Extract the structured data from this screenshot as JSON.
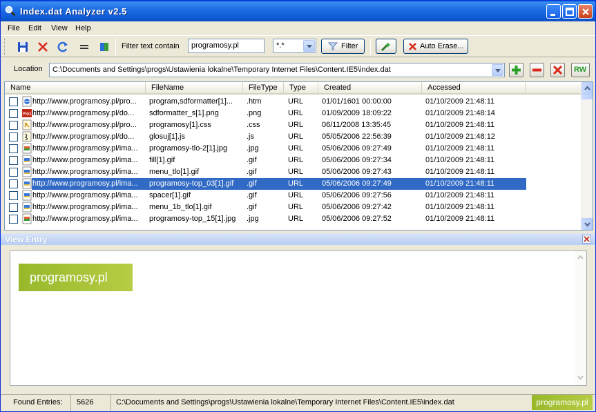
{
  "window": {
    "title": "Index.dat Analyzer v2.5"
  },
  "menu": [
    "File",
    "Edit",
    "View",
    "Help"
  ],
  "toolbar": {
    "filter_label": "Filter text contain",
    "filter_value": "programosy.pl",
    "ext_value": "*.*",
    "filter_button": "Filter",
    "auto_erase_button": "Auto Erase..."
  },
  "location": {
    "label": "Location",
    "path": "C:\\Documents and Settings\\progs\\Ustawienia lokalne\\Temporary Internet Files\\Content.IE5\\index.dat",
    "rw_label": "RW"
  },
  "columns": [
    "Name",
    "FileName",
    "FileType",
    "Type",
    "Created",
    "Accessed"
  ],
  "rows": [
    {
      "name": "http://www.programosy.pl/pro...",
      "file": "program,sdformatter[1]...",
      "ext": ".htm",
      "type": "URL",
      "created": "01/01/1601   00:00:00",
      "accessed": "01/10/2009   21:48:11",
      "icon": "htm-icon"
    },
    {
      "name": "http://www.programosy.pl/do...",
      "file": "sdformatter_s[1].png",
      "ext": ".png",
      "type": "URL",
      "created": "01/09/2009   18:09:22",
      "accessed": "01/10/2009   21:48:14",
      "icon": "png-icon"
    },
    {
      "name": "http://www.programosy.pl/pro...",
      "file": "programosy[1].css",
      "ext": ".css",
      "type": "URL",
      "created": "06/11/2008   13:35:45",
      "accessed": "01/10/2009   21:48:11",
      "icon": "css-icon"
    },
    {
      "name": "http://www.programosy.pl/do...",
      "file": "glosuj[1].js",
      "ext": ".js",
      "type": "URL",
      "created": "05/05/2006   22:56:39",
      "accessed": "01/10/2009   21:48:12",
      "icon": "js-icon"
    },
    {
      "name": "http://www.programosy.pl/ima...",
      "file": "programosy-tlo-2[1].jpg",
      "ext": ".jpg",
      "type": "URL",
      "created": "05/06/2006   09:27:49",
      "accessed": "01/10/2009   21:48:11",
      "icon": "jpg-icon"
    },
    {
      "name": "http://www.programosy.pl/ima...",
      "file": "fill[1].gif",
      "ext": ".gif",
      "type": "URL",
      "created": "05/06/2006   09:27:34",
      "accessed": "01/10/2009   21:48:11",
      "icon": "gif-icon"
    },
    {
      "name": "http://www.programosy.pl/ima...",
      "file": "menu_tlo[1].gif",
      "ext": ".gif",
      "type": "URL",
      "created": "05/06/2006   09:27:43",
      "accessed": "01/10/2009   21:48:11",
      "icon": "gif-icon"
    },
    {
      "name": "http://www.programosy.pl/ima...",
      "file": "programosy-top_03[1].gif",
      "ext": ".gif",
      "type": "URL",
      "created": "05/06/2006   09:27:49",
      "accessed": "01/10/2009   21:48:11",
      "icon": "gif-icon",
      "selected": true
    },
    {
      "name": "http://www.programosy.pl/ima...",
      "file": "spacer[1].gif",
      "ext": ".gif",
      "type": "URL",
      "created": "05/06/2006   09:27:56",
      "accessed": "01/10/2009   21:48:11",
      "icon": "gif-icon"
    },
    {
      "name": "http://www.programosy.pl/ima...",
      "file": "menu_1b_tlo[1].gif",
      "ext": ".gif",
      "type": "URL",
      "created": "05/06/2006   09:27:42",
      "accessed": "01/10/2009   21:48:11",
      "icon": "gif-icon"
    },
    {
      "name": "http://www.programosy.pl/ima...",
      "file": "programosy-top_15[1].jpg",
      "ext": ".jpg",
      "type": "URL",
      "created": "05/06/2006   09:27:52",
      "accessed": "01/10/2009   21:48:11",
      "icon": "jpg-icon"
    }
  ],
  "view_entry": {
    "title": "View Entry",
    "banner_text": "programosy.pl"
  },
  "status": {
    "found_label": "Found Entries:",
    "found_count": "5626",
    "path": "C:\\Documents and Settings\\progs\\Ustawienia lokalne\\Temporary Internet Files\\Content.IE5\\index.dat",
    "logo_text": "programosy.pl"
  }
}
